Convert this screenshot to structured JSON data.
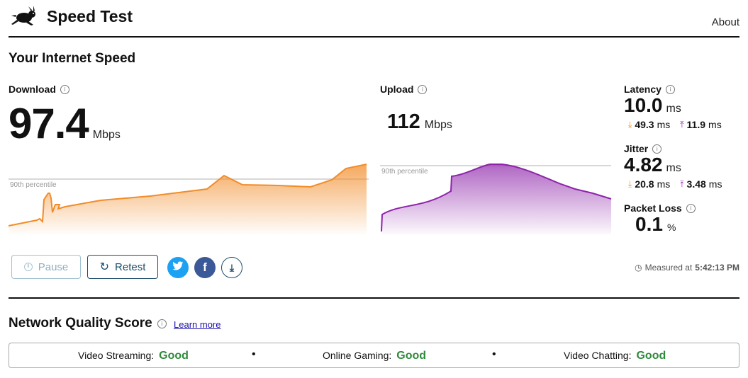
{
  "header": {
    "title": "Speed Test",
    "about_label": "About"
  },
  "section_title": "Your Internet Speed",
  "download": {
    "label": "Download",
    "value": "97.4",
    "unit": "Mbps",
    "percentile_label": "90th percentile",
    "color": "#f28c28"
  },
  "upload": {
    "label": "Upload",
    "value": "112",
    "unit": "Mbps",
    "percentile_label": "90th percentile",
    "color": "#8e24aa"
  },
  "latency": {
    "label": "Latency",
    "value": "10.0",
    "unit": "ms",
    "down_value": "49.3",
    "up_value": "11.9",
    "sub_unit": "ms"
  },
  "jitter": {
    "label": "Jitter",
    "value": "4.82",
    "unit": "ms",
    "down_value": "20.8",
    "up_value": "3.48",
    "sub_unit": "ms"
  },
  "packet_loss": {
    "label": "Packet Loss",
    "value": "0.1",
    "unit": "%"
  },
  "actions": {
    "pause_label": "Pause",
    "retest_label": "Retest",
    "twitter_color": "#1da1f2",
    "facebook_color": "#3b5998"
  },
  "measured_at": {
    "prefix": "Measured at",
    "time": "5:42:13 PM"
  },
  "network_quality": {
    "title": "Network Quality Score",
    "learn_more": "Learn more",
    "items": [
      {
        "label": "Video Streaming:",
        "value": "Good"
      },
      {
        "label": "Online Gaming:",
        "value": "Good"
      },
      {
        "label": "Video Chatting:",
        "value": "Good"
      }
    ],
    "separator": "•"
  }
}
